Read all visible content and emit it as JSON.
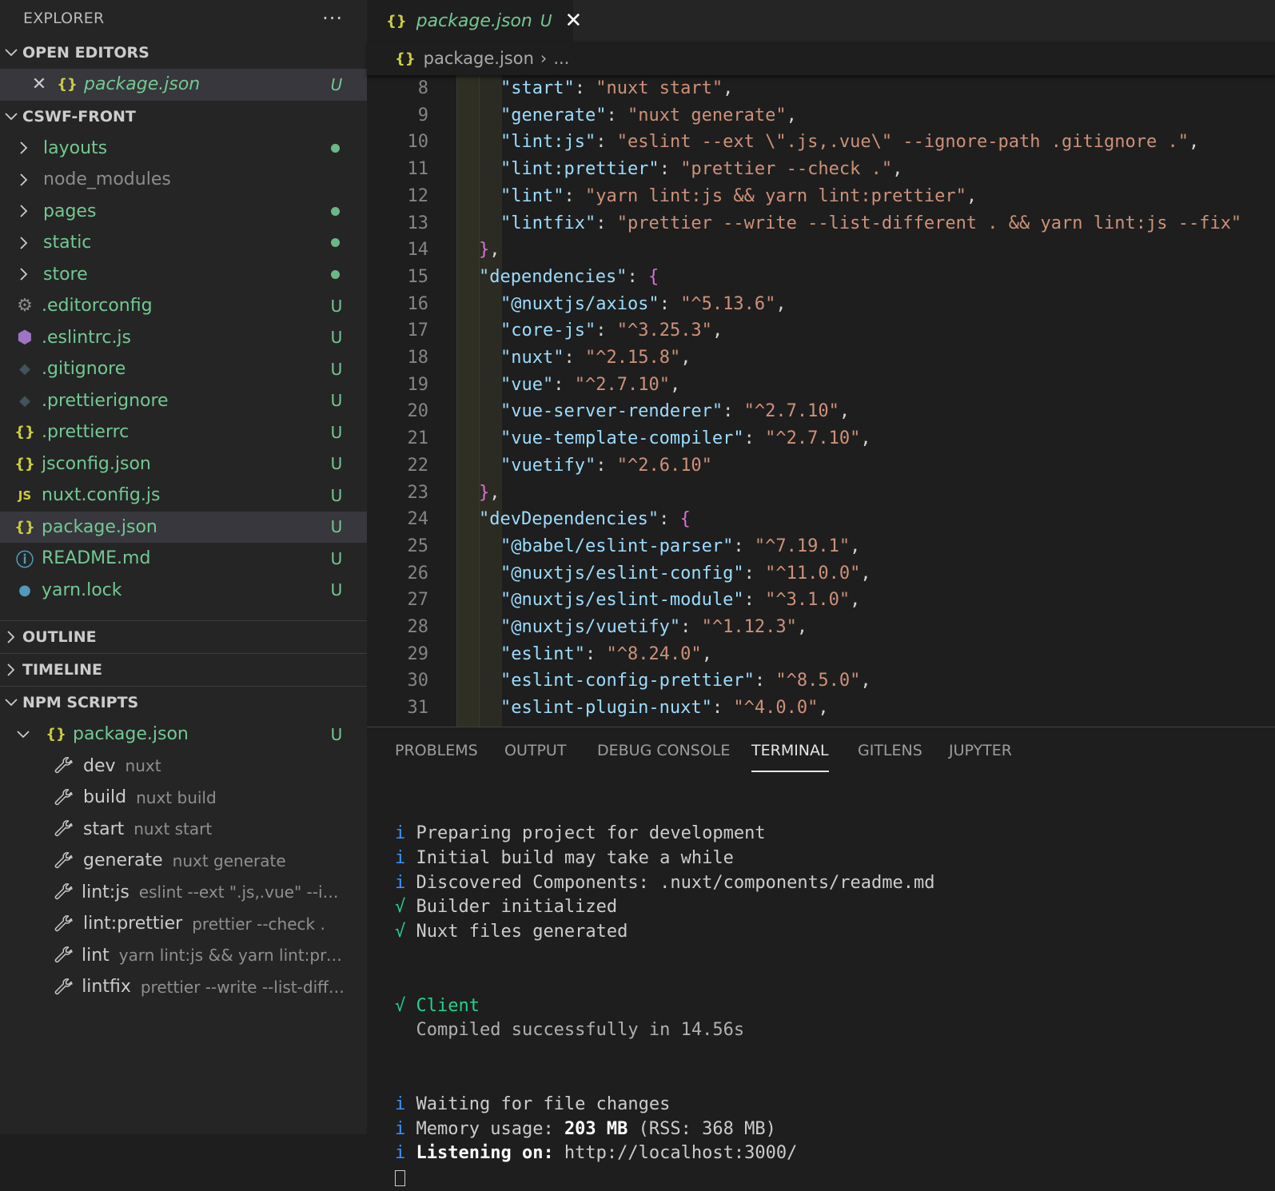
{
  "sidebar": {
    "title": "EXPLORER",
    "more": "···",
    "open_editors": {
      "label": "OPEN EDITORS",
      "items": [
        {
          "icon": "{}",
          "label": "package.json",
          "badge": "U"
        }
      ]
    },
    "project": {
      "label": "CSWF-FRONT",
      "folders": [
        {
          "label": "layouts",
          "modified": true
        },
        {
          "label": "node_modules",
          "modified": false
        },
        {
          "label": "pages",
          "modified": true
        },
        {
          "label": "static",
          "modified": true
        },
        {
          "label": "store",
          "modified": true
        }
      ],
      "files": [
        {
          "label": ".editorconfig",
          "icon": "gear-icon",
          "badge": "U"
        },
        {
          "label": ".eslintrc.js",
          "icon": "eslint-icon",
          "badge": "U"
        },
        {
          "label": ".gitignore",
          "icon": "git-icon",
          "badge": "U"
        },
        {
          "label": ".prettierignore",
          "icon": "git-icon",
          "badge": "U"
        },
        {
          "label": ".prettierrc",
          "icon": "{}",
          "badge": "U"
        },
        {
          "label": "jsconfig.json",
          "icon": "{}",
          "badge": "U"
        },
        {
          "label": "nuxt.config.js",
          "icon": "JS",
          "badge": "U"
        },
        {
          "label": "package.json",
          "icon": "{}",
          "badge": "U"
        },
        {
          "label": "README.md",
          "icon": "info-icon",
          "badge": "U"
        },
        {
          "label": "yarn.lock",
          "icon": "yarn-icon",
          "badge": "U"
        }
      ]
    },
    "outline_label": "OUTLINE",
    "timeline_label": "TIMELINE",
    "npm_scripts": {
      "label": "NPM SCRIPTS",
      "package": {
        "label": "package.json",
        "badge": "U"
      },
      "scripts": [
        {
          "name": "dev",
          "cmd": "nuxt"
        },
        {
          "name": "build",
          "cmd": "nuxt build"
        },
        {
          "name": "start",
          "cmd": "nuxt start"
        },
        {
          "name": "generate",
          "cmd": "nuxt generate"
        },
        {
          "name": "lint:js",
          "cmd": "eslint --ext \".js,.vue\" --igno..."
        },
        {
          "name": "lint:prettier",
          "cmd": "prettier --check ."
        },
        {
          "name": "lint",
          "cmd": "yarn lint:js && yarn lint:prettier"
        },
        {
          "name": "lintfix",
          "cmd": "prettier --write --list-differ..."
        }
      ]
    }
  },
  "editor": {
    "tab": {
      "icon": "{}",
      "label": "package.json",
      "badge": "U",
      "close": "✕"
    },
    "breadcrumb": {
      "icon": "{}",
      "file": "package.json",
      "more": "..."
    },
    "lines": [
      {
        "n": "8",
        "indent": 2,
        "key": "start",
        "val": "nuxt start",
        "comma": true
      },
      {
        "n": "9",
        "indent": 2,
        "key": "generate",
        "val": "nuxt generate",
        "comma": true
      },
      {
        "n": "10",
        "indent": 2,
        "key": "lint:js",
        "val": "eslint --ext \\\".js,.vue\\\" --ignore-path .gitignore .",
        "comma": true
      },
      {
        "n": "11",
        "indent": 2,
        "key": "lint:prettier",
        "val": "prettier --check .",
        "comma": true
      },
      {
        "n": "12",
        "indent": 2,
        "key": "lint",
        "val": "yarn lint:js && yarn lint:prettier",
        "comma": true
      },
      {
        "n": "13",
        "indent": 2,
        "key": "lintfix",
        "val": "prettier --write --list-different . && yarn lint:js --fix",
        "comma": false
      },
      {
        "n": "14",
        "indent": 1,
        "close": "}",
        "comma": true
      },
      {
        "n": "15",
        "indent": 1,
        "key": "dependencies",
        "open": "{"
      },
      {
        "n": "16",
        "indent": 2,
        "key": "@nuxtjs/axios",
        "val": "^5.13.6",
        "comma": true
      },
      {
        "n": "17",
        "indent": 2,
        "key": "core-js",
        "val": "^3.25.3",
        "comma": true
      },
      {
        "n": "18",
        "indent": 2,
        "key": "nuxt",
        "val": "^2.15.8",
        "comma": true
      },
      {
        "n": "19",
        "indent": 2,
        "key": "vue",
        "val": "^2.7.10",
        "comma": true
      },
      {
        "n": "20",
        "indent": 2,
        "key": "vue-server-renderer",
        "val": "^2.7.10",
        "comma": true
      },
      {
        "n": "21",
        "indent": 2,
        "key": "vue-template-compiler",
        "val": "^2.7.10",
        "comma": true
      },
      {
        "n": "22",
        "indent": 2,
        "key": "vuetify",
        "val": "^2.6.10",
        "comma": false
      },
      {
        "n": "23",
        "indent": 1,
        "close": "}",
        "comma": true
      },
      {
        "n": "24",
        "indent": 1,
        "key": "devDependencies",
        "open": "{"
      },
      {
        "n": "25",
        "indent": 2,
        "key": "@babel/eslint-parser",
        "val": "^7.19.1",
        "comma": true
      },
      {
        "n": "26",
        "indent": 2,
        "key": "@nuxtjs/eslint-config",
        "val": "^11.0.0",
        "comma": true
      },
      {
        "n": "27",
        "indent": 2,
        "key": "@nuxtjs/eslint-module",
        "val": "^3.1.0",
        "comma": true
      },
      {
        "n": "28",
        "indent": 2,
        "key": "@nuxtjs/vuetify",
        "val": "^1.12.3",
        "comma": true
      },
      {
        "n": "29",
        "indent": 2,
        "key": "eslint",
        "val": "^8.24.0",
        "comma": true
      },
      {
        "n": "30",
        "indent": 2,
        "key": "eslint-config-prettier",
        "val": "^8.5.0",
        "comma": true
      },
      {
        "n": "31",
        "indent": 2,
        "key": "eslint-plugin-nuxt",
        "val": "^4.0.0",
        "comma": true
      }
    ]
  },
  "panel": {
    "tabs": [
      "PROBLEMS",
      "OUTPUT",
      "DEBUG CONSOLE",
      "TERMINAL",
      "GITLENS",
      "JUPYTER"
    ],
    "active_tab": "TERMINAL",
    "terminal": [
      {
        "mark": "",
        "text": ""
      },
      {
        "mark": "",
        "text": ""
      },
      {
        "mark": "i",
        "text": "Preparing project for development"
      },
      {
        "mark": "i",
        "text": "Initial build may take a while"
      },
      {
        "mark": "i",
        "text": "Discovered Components: .nuxt/components/readme.md"
      },
      {
        "mark": "√",
        "text": "Builder initialized"
      },
      {
        "mark": "√",
        "text": "Nuxt files generated"
      },
      {
        "mark": "",
        "text": ""
      },
      {
        "mark": "√",
        "text": "Client",
        "green": true
      },
      {
        "mark": "",
        "text": "Compiled successfully in 14.56s",
        "dim": true
      },
      {
        "mark": "",
        "text": ""
      },
      {
        "mark": "i",
        "text": "Waiting for file changes"
      },
      {
        "mark": "i",
        "text": "Memory usage: ",
        "bold_part": "203 MB",
        "rest": " (RSS: 368 MB)"
      },
      {
        "mark": "i",
        "text": "",
        "bold_part": "Listening on:",
        "rest": " http://localhost:3000/"
      }
    ]
  },
  "colors": {
    "accent_green": "#73c991",
    "terminal_blue": "#3794ff",
    "terminal_green": "#23d18b"
  }
}
